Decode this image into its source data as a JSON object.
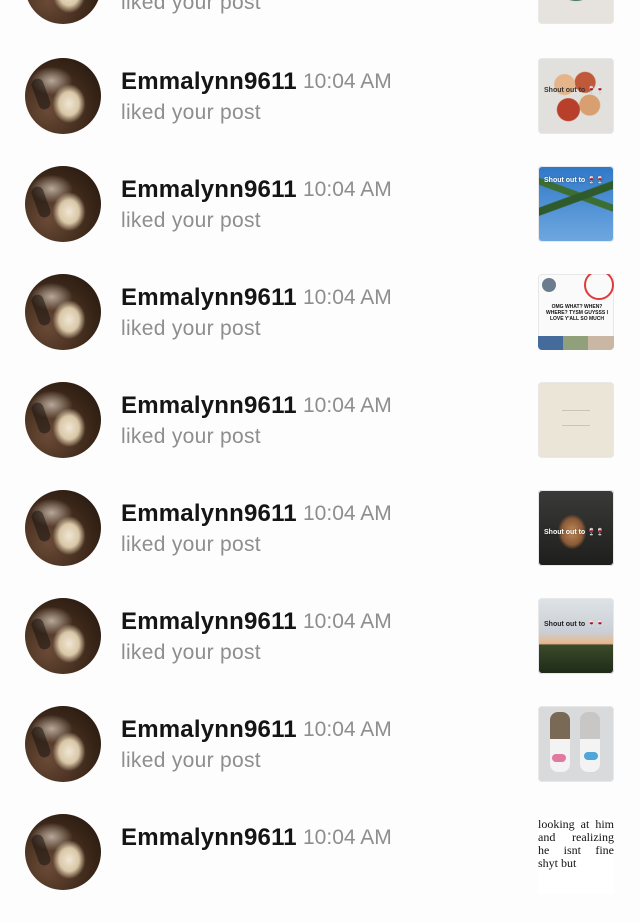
{
  "notifications": [
    {
      "username": "",
      "time": "",
      "action": "liked your post",
      "thumb_text": ""
    },
    {
      "username": "Emmalynn9611",
      "time": "10:04 AM",
      "action": "liked your post",
      "thumb_text": "Shout out to 🍷🍷"
    },
    {
      "username": "Emmalynn9611",
      "time": "10:04 AM",
      "action": "liked your post",
      "thumb_text": "Shout out to 🍷🍷"
    },
    {
      "username": "Emmalynn9611",
      "time": "10:04 AM",
      "action": "liked your post",
      "thumb_text": "OMG WHAT? WHEN? WHERE? TYSM GUYSSS I LOVE Y'ALL SO MUCH"
    },
    {
      "username": "Emmalynn9611",
      "time": "10:04 AM",
      "action": "liked your post",
      "thumb_text": ""
    },
    {
      "username": "Emmalynn9611",
      "time": "10:04 AM",
      "action": "liked your post",
      "thumb_text": "Shout out to 🍷🍷"
    },
    {
      "username": "Emmalynn9611",
      "time": "10:04 AM",
      "action": "liked your post",
      "thumb_text": "Shout out to 🍷🍷"
    },
    {
      "username": "Emmalynn9611",
      "time": "10:04 AM",
      "action": "liked your post",
      "thumb_text": ""
    },
    {
      "username": "Emmalynn9611",
      "time": "10:04 AM",
      "action": "",
      "thumb_text": "looking at him and realizing he isnt fine shyt but"
    }
  ]
}
